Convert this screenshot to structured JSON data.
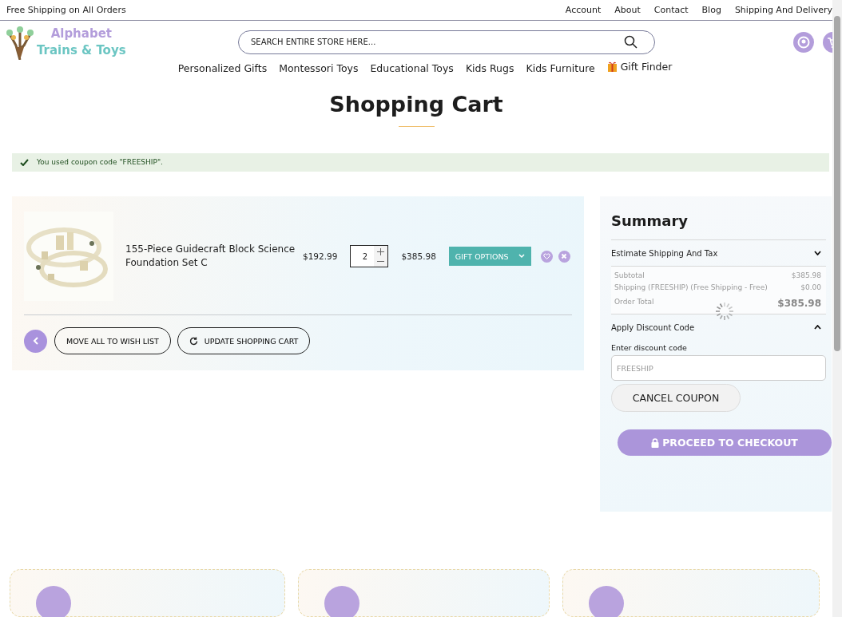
{
  "top_bar": {
    "promo": "Free Shipping on All Orders",
    "links": [
      "Account",
      "About",
      "Contact",
      "Blog",
      "Shipping And Delivery"
    ]
  },
  "logo": {
    "line_1": "Alphabet",
    "line_2": "Trains & Toys"
  },
  "search": {
    "placeholder": "SEARCH ENTIRE STORE HERE..."
  },
  "nav": [
    {
      "label": "Personalized Gifts",
      "kind": "link"
    },
    {
      "label": "Montessori Toys",
      "kind": "link"
    },
    {
      "label": "Educational Toys",
      "kind": "link"
    },
    {
      "label": "Kids Rugs",
      "kind": "link"
    },
    {
      "label": "Kids Furniture",
      "kind": "link"
    },
    {
      "label": "Gift Finder",
      "kind": "gift"
    }
  ],
  "page_title": "Shopping Cart",
  "message": "You used coupon code \"FREESHIP\".",
  "cart": {
    "items": [
      {
        "name": "155-Piece Guidecraft Block Science Foundation Set C",
        "price": "$192.99",
        "quantity": "2",
        "subtotal": "$385.98",
        "gift_button": "GIFT OPTIONS"
      }
    ],
    "buttons": [
      "MOVE ALL TO WISH LIST",
      "UPDATE SHOPPING CART"
    ]
  },
  "summary": {
    "title": "Summary",
    "loading": true,
    "shipping_section": {
      "label": "Estimate Shipping And Tax",
      "expanded": false
    },
    "totals": [
      {
        "label": "Subtotal",
        "value": "$385.98",
        "kind": "line"
      },
      {
        "label": "Shipping (FREESHIP) (Free Shipping - Free)",
        "value": "$0.00",
        "kind": "line"
      },
      {
        "label": "Order Total",
        "value": "$385.98",
        "kind": "total"
      }
    ],
    "discount_section": {
      "label": "Apply Discount Code",
      "expanded": true,
      "field_label": "Enter discount code",
      "value": "FREESHIP",
      "button": "CANCEL COUPON"
    },
    "checkout_button": "PROCEED TO CHECKOUT"
  }
}
